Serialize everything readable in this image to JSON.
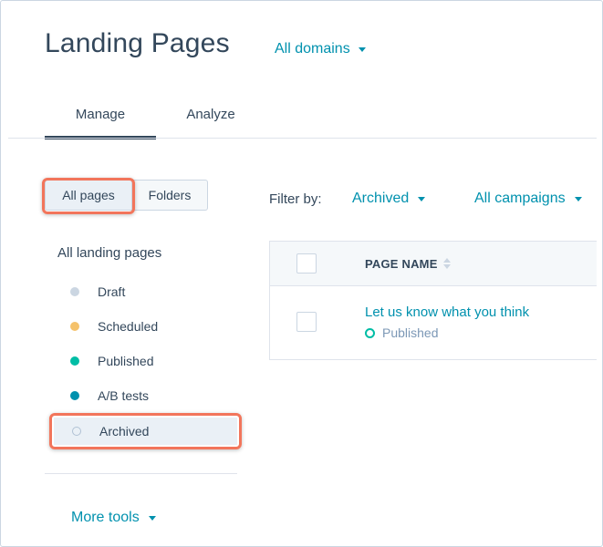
{
  "header": {
    "title": "Landing Pages",
    "domain_filter": "All domains"
  },
  "tabs": [
    {
      "label": "Manage",
      "active": true
    },
    {
      "label": "Analyze",
      "active": false
    }
  ],
  "sidebar": {
    "view_toggle": {
      "all_pages": "All pages",
      "folders": "Folders",
      "selected": "All pages"
    },
    "heading": "All landing pages",
    "items": [
      {
        "label": "Draft",
        "color": "#cbd6e2"
      },
      {
        "label": "Scheduled",
        "color": "#f5c26b"
      },
      {
        "label": "Published",
        "color": "#00bda5"
      },
      {
        "label": "A/B tests",
        "color": "#0091ae"
      },
      {
        "label": "Archived",
        "color": "outline",
        "active": true
      }
    ],
    "more_tools": "More tools"
  },
  "filters": {
    "label": "Filter by:",
    "status": "Archived",
    "campaign": "All campaigns"
  },
  "table": {
    "columns": [
      "PAGE NAME"
    ],
    "rows": [
      {
        "name": "Let us know what you think",
        "status": "Published"
      }
    ]
  },
  "colors": {
    "accent": "#0091ae",
    "text": "#33475b",
    "published": "#00bda5",
    "highlight": "#f2755b"
  }
}
